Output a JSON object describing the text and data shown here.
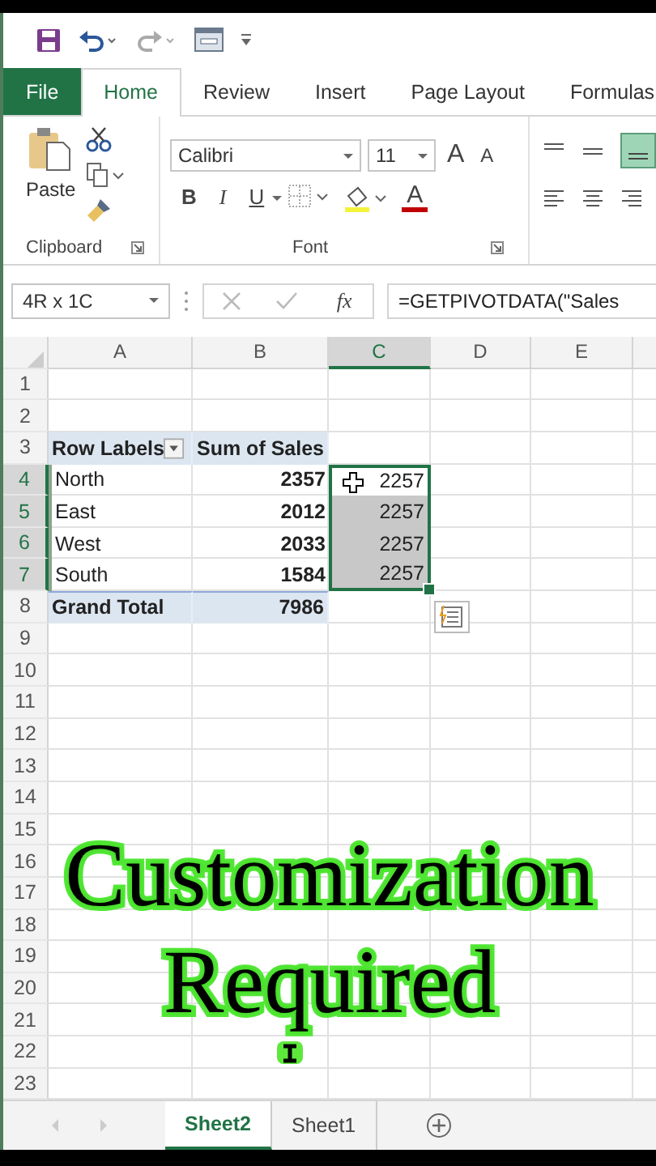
{
  "ribbon_tabs": [
    {
      "label": "File",
      "kind": "file",
      "selected": false
    },
    {
      "label": "Home",
      "kind": "tab",
      "selected": true
    },
    {
      "label": "Review",
      "kind": "tab",
      "selected": false
    },
    {
      "label": "Insert",
      "kind": "tab",
      "selected": false
    },
    {
      "label": "Page Layout",
      "kind": "tab",
      "selected": false
    },
    {
      "label": "Formulas",
      "kind": "tab",
      "selected": false
    }
  ],
  "clipboard": {
    "paste_label": "Paste",
    "group_label": "Clipboard"
  },
  "font": {
    "font_name": "Calibri",
    "font_size": "11",
    "grow": "A",
    "shrink": "A",
    "bold": "B",
    "italic": "I",
    "underline": "U",
    "font_color": "A",
    "group_label": "Font"
  },
  "formula_bar": {
    "name_box": "4R x 1C",
    "fx": "fx",
    "formula": "=GETPIVOTDATA(\"Sales"
  },
  "columns": [
    {
      "label": "A",
      "selected": false
    },
    {
      "label": "B",
      "selected": false
    },
    {
      "label": "C",
      "selected": true
    },
    {
      "label": "D",
      "selected": false
    },
    {
      "label": "E",
      "selected": false
    }
  ],
  "rows": [
    {
      "number": "1",
      "kind": "blank",
      "selected": false
    },
    {
      "number": "2",
      "kind": "blank",
      "selected": false
    },
    {
      "number": "3",
      "kind": "pivot_header",
      "selected": false,
      "a": "Row Labels",
      "b": "Sum of Sales"
    },
    {
      "number": "4",
      "kind": "pivot_item",
      "selected": true,
      "a": "North",
      "b": "2357",
      "c": "2257"
    },
    {
      "number": "5",
      "kind": "pivot_item",
      "selected": true,
      "a": "East",
      "b": "2012",
      "c": "2257"
    },
    {
      "number": "6",
      "kind": "pivot_item",
      "selected": true,
      "a": "West",
      "b": "2033",
      "c": "2257"
    },
    {
      "number": "7",
      "kind": "pivot_item",
      "selected": true,
      "a": "South",
      "b": "1584",
      "c": "2257"
    },
    {
      "number": "8",
      "kind": "grand_total",
      "selected": false,
      "a": "Grand Total",
      "b": "7986"
    },
    {
      "number": "9",
      "kind": "blank",
      "selected": false
    },
    {
      "number": "10",
      "kind": "blank",
      "selected": false
    },
    {
      "number": "11",
      "kind": "blank",
      "selected": false
    },
    {
      "number": "12",
      "kind": "blank",
      "selected": false
    },
    {
      "number": "13",
      "kind": "blank",
      "selected": false
    },
    {
      "number": "14",
      "kind": "blank",
      "selected": false
    },
    {
      "number": "15",
      "kind": "blank",
      "selected": false
    },
    {
      "number": "16",
      "kind": "blank",
      "selected": false
    },
    {
      "number": "17",
      "kind": "blank",
      "selected": false
    },
    {
      "number": "18",
      "kind": "blank",
      "selected": false
    },
    {
      "number": "19",
      "kind": "blank",
      "selected": false
    },
    {
      "number": "20",
      "kind": "blank",
      "selected": false
    },
    {
      "number": "21",
      "kind": "blank",
      "selected": false
    },
    {
      "number": "22",
      "kind": "blank",
      "selected": false
    },
    {
      "number": "23",
      "kind": "blank",
      "selected": false
    }
  ],
  "sheet_tabs": [
    {
      "label": "Sheet2",
      "selected": true
    },
    {
      "label": "Sheet1",
      "selected": false
    }
  ],
  "caption": [
    "Customization",
    "Required"
  ]
}
